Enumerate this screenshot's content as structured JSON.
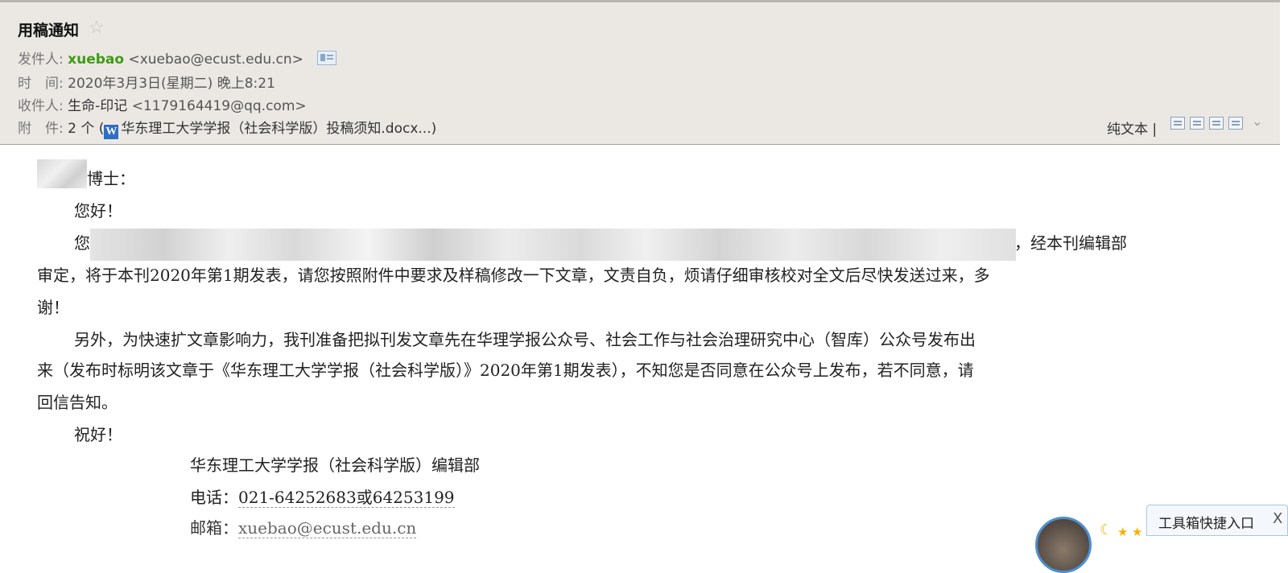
{
  "email": {
    "subject": "用稿通知",
    "star_icon": "☆",
    "sender": {
      "label": "发件人:",
      "name": "xuebao",
      "address": "<xuebao@ecust.edu.cn>"
    },
    "time": {
      "label": "时　间:",
      "value": "2020年3月3日(星期二) 晚上8:21"
    },
    "recipient": {
      "label": "收件人:",
      "name": "生命-印记",
      "address": "<1179164419@qq.com>"
    },
    "attachments": {
      "label": "附　件:",
      "count": "2 个 (",
      "file": "华东理工大学学报（社会科学版）投稿须知.docx...)"
    },
    "actions": {
      "plain_text": "纯文本 |"
    }
  },
  "body": {
    "greeting_suffix": "博士：",
    "hello": "您好！",
    "p1_start": "您",
    "p1_end": "一文，经本刊编辑部",
    "p1_line2": "审定，将于本刊2020年第1期发表，请您按照附件中要求及样稿修改一下文章，文责自负，烦请仔细审核校对全文后尽快发送过来，多",
    "p1_line3": "谢！",
    "p2_line1": "另外，为快速扩文章影响力，我刊准备把拟刊发文章先在华理学报公众号、社会工作与社会治理研究中心（智库）公众号发布出",
    "p2_line2": "来（发布时标明该文章于《华东理工大学学报（社会科学版）》2020年第1期发表），不知您是否同意在公众号上发布，若不同意，请",
    "p2_line3": "回信告知。",
    "closing": "祝好！",
    "sig_org": "华东理工大学学报（社会科学版）编辑部",
    "sig_phone_label": "电话：",
    "sig_phone_value": "021-64252683或64253199",
    "sig_email_label": "邮箱：",
    "sig_email_value": "xuebao@ecust.edu.cn"
  },
  "toolbox": {
    "label": "工具箱快捷入口",
    "close": "X"
  }
}
